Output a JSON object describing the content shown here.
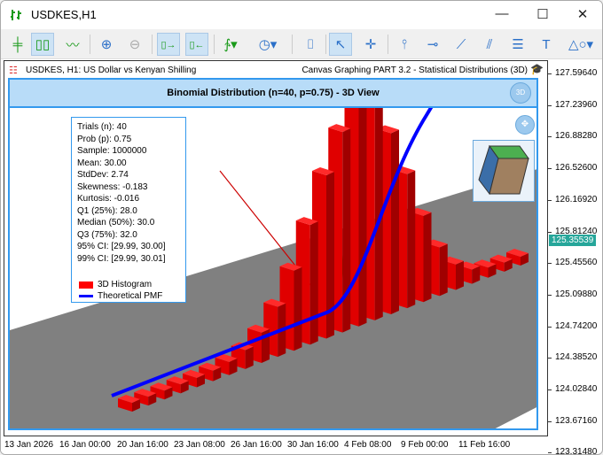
{
  "window": {
    "title": "USDKES,H1",
    "minimize": "—",
    "maximize": "☐",
    "close": "✕"
  },
  "toolbar": {
    "icons": [
      "bar-chart-icon",
      "candlestick-icon",
      "line-chart-icon",
      "zoom-in-icon",
      "zoom-out-icon",
      "chart-shift-icon",
      "autoscroll-icon",
      "indicators-icon",
      "periods-icon",
      "screenshot-icon",
      "cursor-icon",
      "crosshair-icon",
      "vertical-line-icon",
      "horizontal-line-icon",
      "trendline-icon",
      "channel-icon",
      "fibonacci-icon",
      "text-icon",
      "shapes-icon"
    ]
  },
  "chart": {
    "symbol_label": "USDKES, H1:  US Dollar vs Kenyan Shilling",
    "indicator_label": "Canvas Graphing PART 3.2 - Statistical Distributions (3D)",
    "current_price": "125.35539",
    "y_labels": [
      "127.59640",
      "127.23960",
      "126.88280",
      "126.52600",
      "126.16920",
      "125.81240",
      "125.45560",
      "125.09880",
      "124.74200",
      "124.38520",
      "124.02840",
      "123.67160",
      "123.31480"
    ],
    "x_labels": [
      "13 Jan 2026",
      "16 Jan 00:00",
      "20 Jan 16:00",
      "23 Jan 08:00",
      "26 Jan 16:00",
      "30 Jan 16:00",
      "4 Feb 08:00",
      "9 Feb 00:00",
      "11 Feb 16:00"
    ]
  },
  "panel": {
    "title": "Binomial Distribution (n=40, p=0.75) - 3D View",
    "view_button": "3D",
    "stats": [
      "Trials (n): 40",
      "Prob (p): 0.75",
      "Sample: 1000000",
      "Mean: 30.00",
      "StdDev: 2.74",
      "Skewness: -0.183",
      "Kurtosis: -0.016",
      "Q1 (25%): 28.0",
      "Median (50%): 30.0",
      "Q3 (75%): 32.0",
      "95% CI: [29.99, 30.00]",
      "99% CI: [29.99, 30.01]"
    ],
    "legend": [
      {
        "label": "3D Histogram",
        "color": "#ff0000"
      },
      {
        "label": "Theoretical PMF",
        "color": "#0000ff"
      }
    ],
    "n": 40,
    "p": 0.75
  }
}
